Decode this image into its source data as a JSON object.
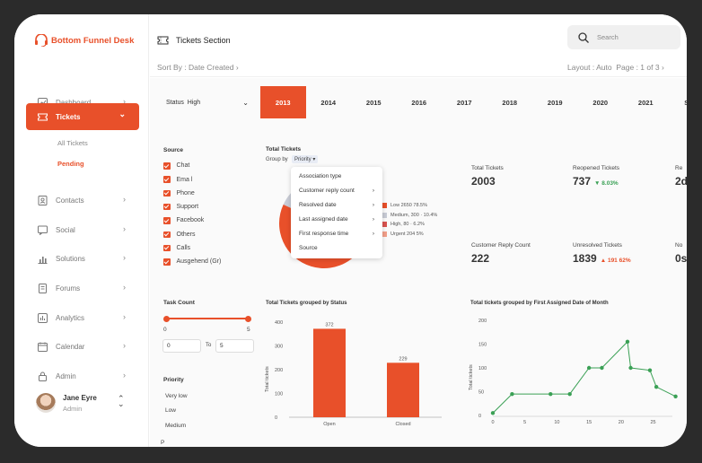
{
  "app": {
    "title": "Bottom Funnel Desk"
  },
  "colors": {
    "accent": "#e8502a",
    "green": "#3aa055"
  },
  "sidebar": {
    "items": [
      {
        "label": "Dashboard",
        "icon": "chart-line-icon"
      },
      {
        "label": "Tickets",
        "icon": "ticket-icon",
        "active": true
      },
      {
        "label": "Contacts",
        "icon": "contacts-icon"
      },
      {
        "label": "Social",
        "icon": "message-icon"
      },
      {
        "label": "Solutions",
        "icon": "bar-chart-icon"
      },
      {
        "label": "Forums",
        "icon": "document-icon"
      },
      {
        "label": "Analytics",
        "icon": "analytics-icon"
      },
      {
        "label": "Calendar",
        "icon": "calendar-icon"
      },
      {
        "label": "Admin",
        "icon": "lock-icon"
      }
    ],
    "sub_items": [
      {
        "label": "All Tickets",
        "active": false
      },
      {
        "label": "Pending",
        "active": true
      }
    ],
    "user": {
      "name": "Jane Eyre",
      "role": "Admin"
    }
  },
  "header": {
    "section_title": "Tickets Section",
    "search_placeholder": "Search",
    "sort_by": "Sort By : Date Created",
    "layout": "Layout : Auto",
    "pagination": "Page : 1 of 3"
  },
  "filters": {
    "status_label": "Status",
    "status_value": "High",
    "years": [
      "2013",
      "2014",
      "2015",
      "2016",
      "2017",
      "2018",
      "2019",
      "2020",
      "2021",
      "SLA"
    ],
    "selected_year": "2013",
    "source_label": "Source",
    "sources": [
      "Chat",
      "Ema l",
      "Phone",
      "Support",
      "Facebook",
      "Others",
      "Calls",
      "Ausgehend (Gr)"
    ],
    "task_count_label": "Task Count",
    "task_min": "0",
    "task_max": "5",
    "range_from": "0",
    "range_to_label": "To",
    "range_to": "5",
    "priority_label": "Priority",
    "priorities": [
      "Very low",
      "Low",
      "Medium"
    ],
    "cut_off_label": "P"
  },
  "total_tickets_widget": {
    "title": "Total Tickets",
    "group_by_label": "Group by",
    "group_by_value": "Priority",
    "menu": [
      {
        "label": "Association type",
        "submenu": false
      },
      {
        "label": "Customer reply count",
        "submenu": true
      },
      {
        "label": "Resolved date",
        "submenu": true
      },
      {
        "label": "Last assigned date",
        "submenu": true
      },
      {
        "label": "First response time",
        "submenu": true
      },
      {
        "label": "Source",
        "submenu": false
      }
    ]
  },
  "stats": [
    {
      "label": "Total Tickets",
      "value": "2003",
      "delta": "",
      "dir": ""
    },
    {
      "label": "Reopened Tickets",
      "value": "737",
      "delta": "8.03%",
      "dir": "up"
    },
    {
      "label": "Re",
      "value": "2d",
      "delta": "",
      "dir": ""
    },
    {
      "label": "Customer Reply Count",
      "value": "222",
      "delta": "",
      "dir": ""
    },
    {
      "label": "Unresolved Tickets",
      "value": "1839",
      "delta": "191 62%",
      "dir": "down"
    },
    {
      "label": "No",
      "value": "0s",
      "delta": "",
      "dir": ""
    }
  ],
  "chart_data": [
    {
      "type": "pie",
      "title": "Total Tickets",
      "labels": [
        "Low",
        "Medium",
        "High",
        "Urgent"
      ],
      "values": [
        2650,
        300,
        80,
        204
      ],
      "percent_labels": [
        "78.5%",
        "10.4%",
        "6.2%",
        "5%"
      ],
      "legend": [
        "Low  2650   78.5%",
        "Medium, 300  ·  10.4%",
        "High, 80  ·  6.2%",
        "Urgent  204   5%"
      ],
      "colors": [
        "#e8502a",
        "#c9ccd6",
        "#d9534f",
        "#f2a08a"
      ]
    },
    {
      "type": "bar",
      "title": "Total Tickets grouped by Status",
      "categories": [
        "Open",
        "Closed"
      ],
      "values": [
        372,
        229
      ],
      "ylabel": "Total tickets",
      "ylim": [
        0,
        400
      ],
      "yticks": [
        "0",
        "100",
        "200",
        "300",
        "400"
      ],
      "color": "#e8502a"
    },
    {
      "type": "line",
      "title": "Total tickets grouped by First Assigned Date of Month",
      "x": [
        0,
        3,
        9,
        12,
        15,
        17,
        21,
        21.5,
        24.5,
        25.5,
        28.5
      ],
      "y": [
        5,
        45,
        45,
        45,
        100,
        100,
        155,
        100,
        95,
        60,
        40
      ],
      "ylabel": "Total tickets",
      "xlim": [
        0,
        28
      ],
      "ylim": [
        0,
        200
      ],
      "xticks": [
        "0",
        "5",
        "10",
        "15",
        "20",
        "25"
      ],
      "yticks": [
        "0",
        "50",
        "100",
        "150",
        "200"
      ],
      "color": "#3aa055"
    }
  ]
}
